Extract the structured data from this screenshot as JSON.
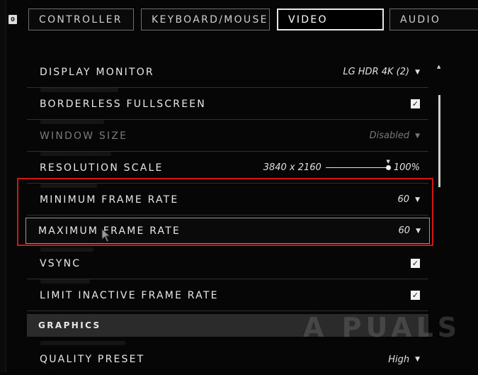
{
  "key_hint": "0",
  "tabs": [
    {
      "label": "CONTROLLER"
    },
    {
      "label": "KEYBOARD/MOUSE"
    },
    {
      "label": "VIDEO"
    },
    {
      "label": "AUDIO"
    }
  ],
  "active_tab": "VIDEO",
  "settings": {
    "display_monitor": {
      "label": "DISPLAY MONITOR",
      "value": "LG HDR 4K (2)"
    },
    "borderless_fullscreen": {
      "label": "BORDERLESS FULLSCREEN",
      "checked": true,
      "check": "✓"
    },
    "window_size": {
      "label": "WINDOW SIZE",
      "value": "Disabled",
      "disabled": true
    },
    "resolution_scale": {
      "label": "RESOLUTION SCALE",
      "resolution": "3840 x 2160",
      "percent": "100%",
      "slider_value": 1.0
    },
    "minimum_frame_rate": {
      "label": "MINIMUM FRAME RATE",
      "value": "60"
    },
    "maximum_frame_rate": {
      "label": "MAXIMUM FRAME RATE",
      "value": "60"
    },
    "vsync": {
      "label": "VSYNC",
      "checked": true,
      "check": "✓"
    },
    "limit_inactive_frame_rate": {
      "label": "LIMIT INACTIVE FRAME RATE",
      "checked": true,
      "check": "✓"
    }
  },
  "section_graphics": "GRAPHICS",
  "quality_preset": {
    "label": "QUALITY PRESET",
    "value": "High"
  },
  "caret_glyph": "▼",
  "watermark": "A PUALS",
  "colors": {
    "highlight": "#d31616",
    "section_bg": "#2b2b2b"
  }
}
